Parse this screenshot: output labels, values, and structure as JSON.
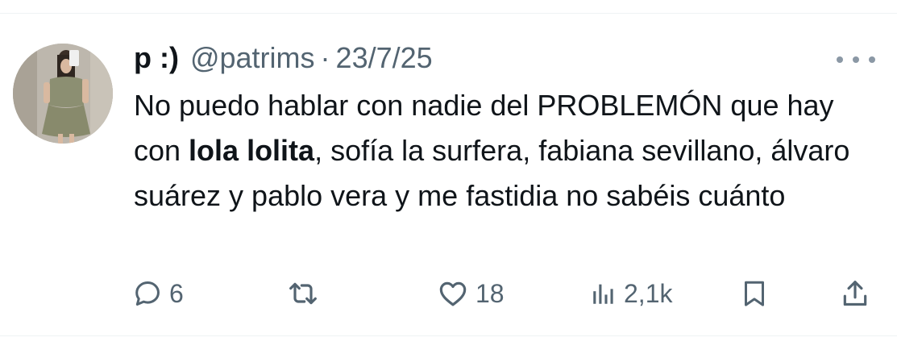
{
  "tweet": {
    "display_name": "p :)",
    "handle": "@patrims",
    "separator": "·",
    "date": "23/7/25",
    "text_before": "No puedo hablar con nadie del PROBLEMÓN que hay con ",
    "text_bold": "lola lolita",
    "text_after": ", sofía la surfera, fabiana sevillano, álvaro suárez y pablo vera y me fastidia no sabéis cuánto"
  },
  "actions": {
    "replies": "6",
    "retweets": "",
    "likes": "18",
    "views": "2,1k"
  },
  "icons": {
    "more": "more-icon",
    "reply": "reply-icon",
    "retweet": "retweet-icon",
    "like": "heart-icon",
    "views": "views-icon",
    "bookmark": "bookmark-icon",
    "share": "share-icon"
  },
  "colors": {
    "text": "#0f1419",
    "secondary": "#536471",
    "divider": "#eff3f4"
  }
}
